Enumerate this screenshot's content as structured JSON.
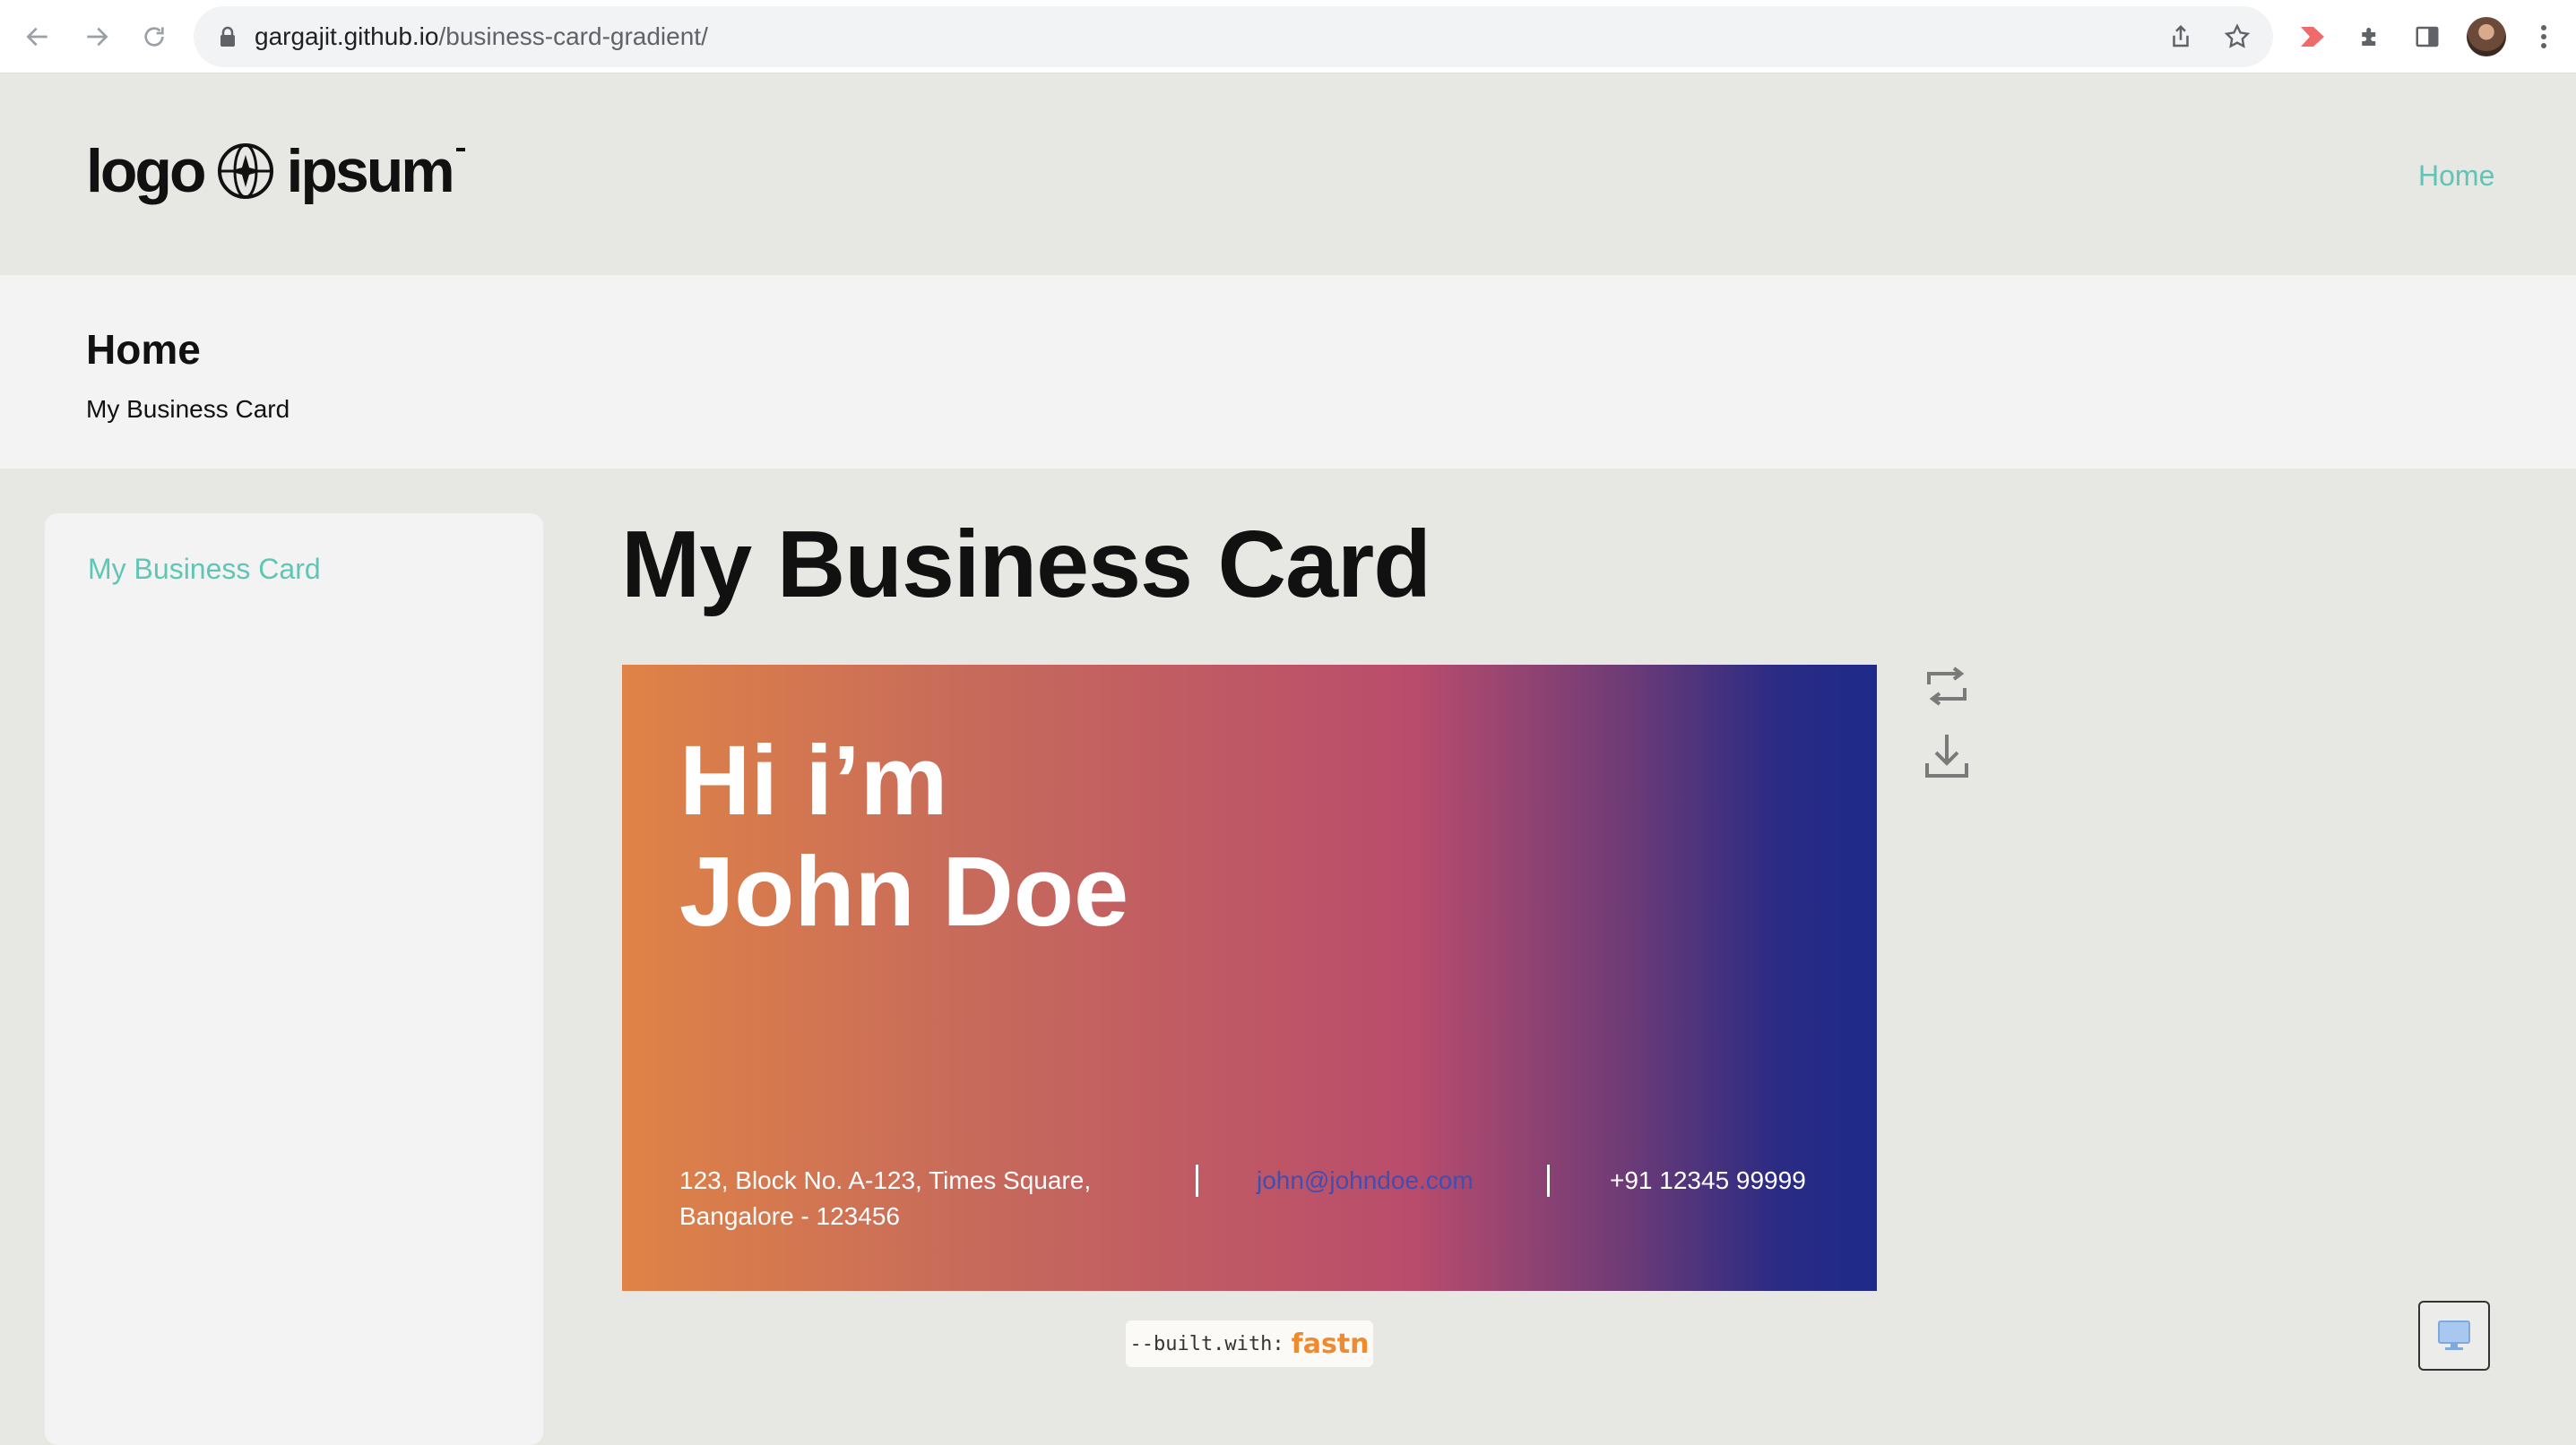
{
  "browser": {
    "url_host": "gargajit.github.io",
    "url_path": "/business-card-gradient/"
  },
  "header": {
    "logo_left": "logo",
    "logo_right": "ipsum",
    "nav_home": "Home"
  },
  "breadcrumb": {
    "title": "Home",
    "current": "My Business Card"
  },
  "sidebar": {
    "items": [
      {
        "label": "My Business Card"
      }
    ]
  },
  "main": {
    "title": "My Business Card"
  },
  "card": {
    "greeting": "Hi i’m",
    "name": "John Doe",
    "address_line1": "123, Block No. A-123, Times Square,",
    "address_line2": "Bangalore - 123456",
    "email": "john@johndoe.com",
    "phone": "+91 12345 99999",
    "actions": [
      "flip-icon",
      "download-icon"
    ]
  },
  "footer": {
    "built_prefix": "--built.with:",
    "built_brand": "fastn"
  },
  "colors": {
    "accent": "#5fc6b6",
    "brand_orange": "#ef8a2f",
    "card_gradient": [
      "#df8347",
      "#b94c6c",
      "#1e2a8a"
    ]
  }
}
